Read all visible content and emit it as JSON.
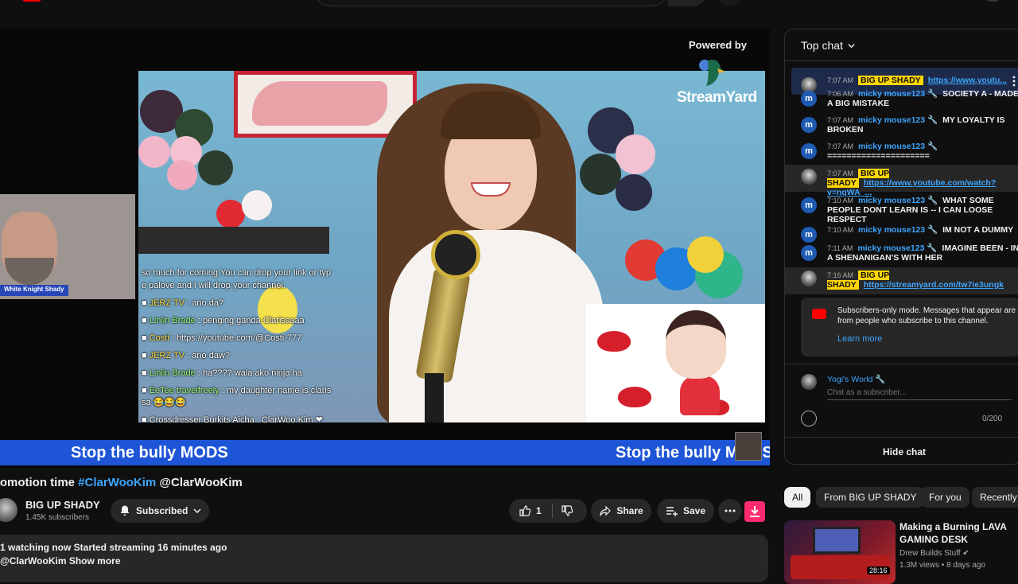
{
  "player": {
    "powered_by": "Powered by",
    "streamyard": "StreamYard",
    "cam_label": "White Knight Shady",
    "banner": [
      "Stop the bully MODS",
      "Stop the bully MODS"
    ],
    "overlay_chat": [
      {
        "name": "",
        "text": "so much for coming.You can drop your link or typ"
      },
      {
        "name": "",
        "text": "e palove and i will drop your channel."
      },
      {
        "name": "JERZ TV",
        "text": ": ano da?"
      },
      {
        "name": "Linlin Brade",
        "text": ": penging ganda Clarissaaa"
      },
      {
        "name": "Costi",
        "text": ": https://youtube.com/@Costi-777"
      },
      {
        "name": "JERZ TV",
        "text": ": ano daw?"
      },
      {
        "name": "Linlin Brade",
        "text": ": ha???? wala ako ninja ha"
      },
      {
        "name": "EeTee travelfreely",
        "text": ": my daughter name is claris"
      },
      {
        "name": "",
        "text": "sa 😂😂😂"
      },
      {
        "name": "Crossdresser Burkits Aicha",
        "text": ": ClarWoo Kim ❤"
      }
    ]
  },
  "video": {
    "title_prefix": "romotion time ",
    "hashtag": "#ClarWooKim",
    "title_suffix": " @ClarWooKim",
    "channel_name": "BIG UP SHADY",
    "subscribers": "1.45K subscribers",
    "subscribed_label": "Subscribed",
    "like_count": "1",
    "share_label": "Share",
    "save_label": "Save",
    "desc_line1": "1 watching now  Started streaming 16 minutes ago",
    "desc_line2": "@ClarWooKim Show more"
  },
  "chat": {
    "header": "Top chat",
    "messages": [
      {
        "time": "7:07 AM",
        "author": "BIG UP SHADY",
        "badge": true,
        "text": "https://www.youtu...",
        "link": true,
        "pinned": true
      },
      {
        "time": "7:06 AM",
        "author": "micky mouse123 🔧",
        "badge": false,
        "text": "SOCIETY A - MADE A BIG MISTAKE",
        "link": false
      },
      {
        "time": "7:07 AM",
        "author": "micky mouse123 🔧",
        "badge": false,
        "text": "MY LOYALTY IS BROKEN",
        "link": false
      },
      {
        "time": "7:07 AM",
        "author": "micky mouse123 🔧",
        "badge": false,
        "text": "=====================",
        "link": false
      },
      {
        "time": "7:07 AM",
        "author": "BIG UP SHADY",
        "badge": true,
        "text": "https://www.youtube.com/watch?v=nqWA_...",
        "link": true
      },
      {
        "time": "7:10 AM",
        "author": "micky mouse123 🔧",
        "badge": false,
        "text": "WHAT SOME PEOPLE DONT LEARN IS -- I CAN LOOSE RESPECT",
        "link": false
      },
      {
        "time": "7:10 AM",
        "author": "micky mouse123 🔧",
        "badge": false,
        "text": "IM NOT A DUMMY",
        "link": false
      },
      {
        "time": "7:11 AM",
        "author": "micky mouse123 🔧",
        "badge": false,
        "text": "IMAGINE BEEN - IN A SHENANIGAN'S WITH HER",
        "link": false
      },
      {
        "time": "7:16 AM",
        "author": "BIG UP SHADY",
        "badge": true,
        "text": "https://streamyard.com/tw7ie3ungk",
        "link": true
      }
    ],
    "avatar_letter": "m",
    "notice_text": "Subscribers-only mode. Messages that appear are from people who subscribe to this channel.",
    "notice_link": "Learn more",
    "input_user": "Yogi's World 🔧",
    "input_placeholder": "Chat as a subscriber...",
    "char_count": "0/200",
    "hide_chat": "Hide chat"
  },
  "chips": [
    "All",
    "From BIG UP SHADY",
    "For you",
    "Recently"
  ],
  "recommendation": {
    "title": "Making a Burning LAVA GAMING DESK",
    "channel": "Drew Builds Stuff ✔",
    "views": "1.3M views  •  8 days ago",
    "duration": "28:16"
  },
  "colors": {
    "accent_blue": "#3ea6ff",
    "badge_yellow": "#ffd600",
    "banner_blue": "#1e55d6",
    "download_pink": "#ff2b6e"
  }
}
